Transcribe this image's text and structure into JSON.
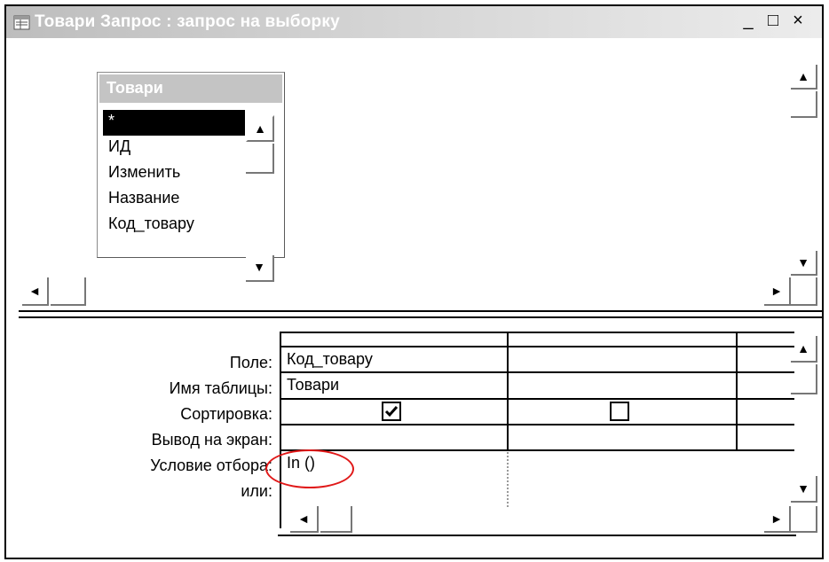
{
  "window": {
    "title": "Товари Запрос : запрос на выборку",
    "controls": {
      "minimize": "_",
      "maximize": "□",
      "close": "×"
    }
  },
  "table_box": {
    "name": "Товари",
    "fields": [
      "*",
      "ИД",
      "Изменить",
      "Название",
      "Код_товару"
    ],
    "selected_field": "*"
  },
  "grid": {
    "row_labels": {
      "field": "Поле:",
      "table": "Имя таблицы:",
      "sort": "Сортировка:",
      "show": "Вывод на экран:",
      "criteria": "Условие отбора:",
      "or": "или:"
    },
    "columns": [
      {
        "field": "Код_товару",
        "table": "Товари",
        "sort": "",
        "show": true,
        "criteria": "In ()",
        "or": ""
      },
      {
        "field": "",
        "table": "",
        "sort": "",
        "show": false,
        "criteria": "",
        "or": ""
      }
    ]
  },
  "annotation": {
    "highlight_color": "#e01818"
  },
  "colors": {
    "titlebar_start": "#bdbdbd",
    "table_header": "#c4c4c4"
  }
}
